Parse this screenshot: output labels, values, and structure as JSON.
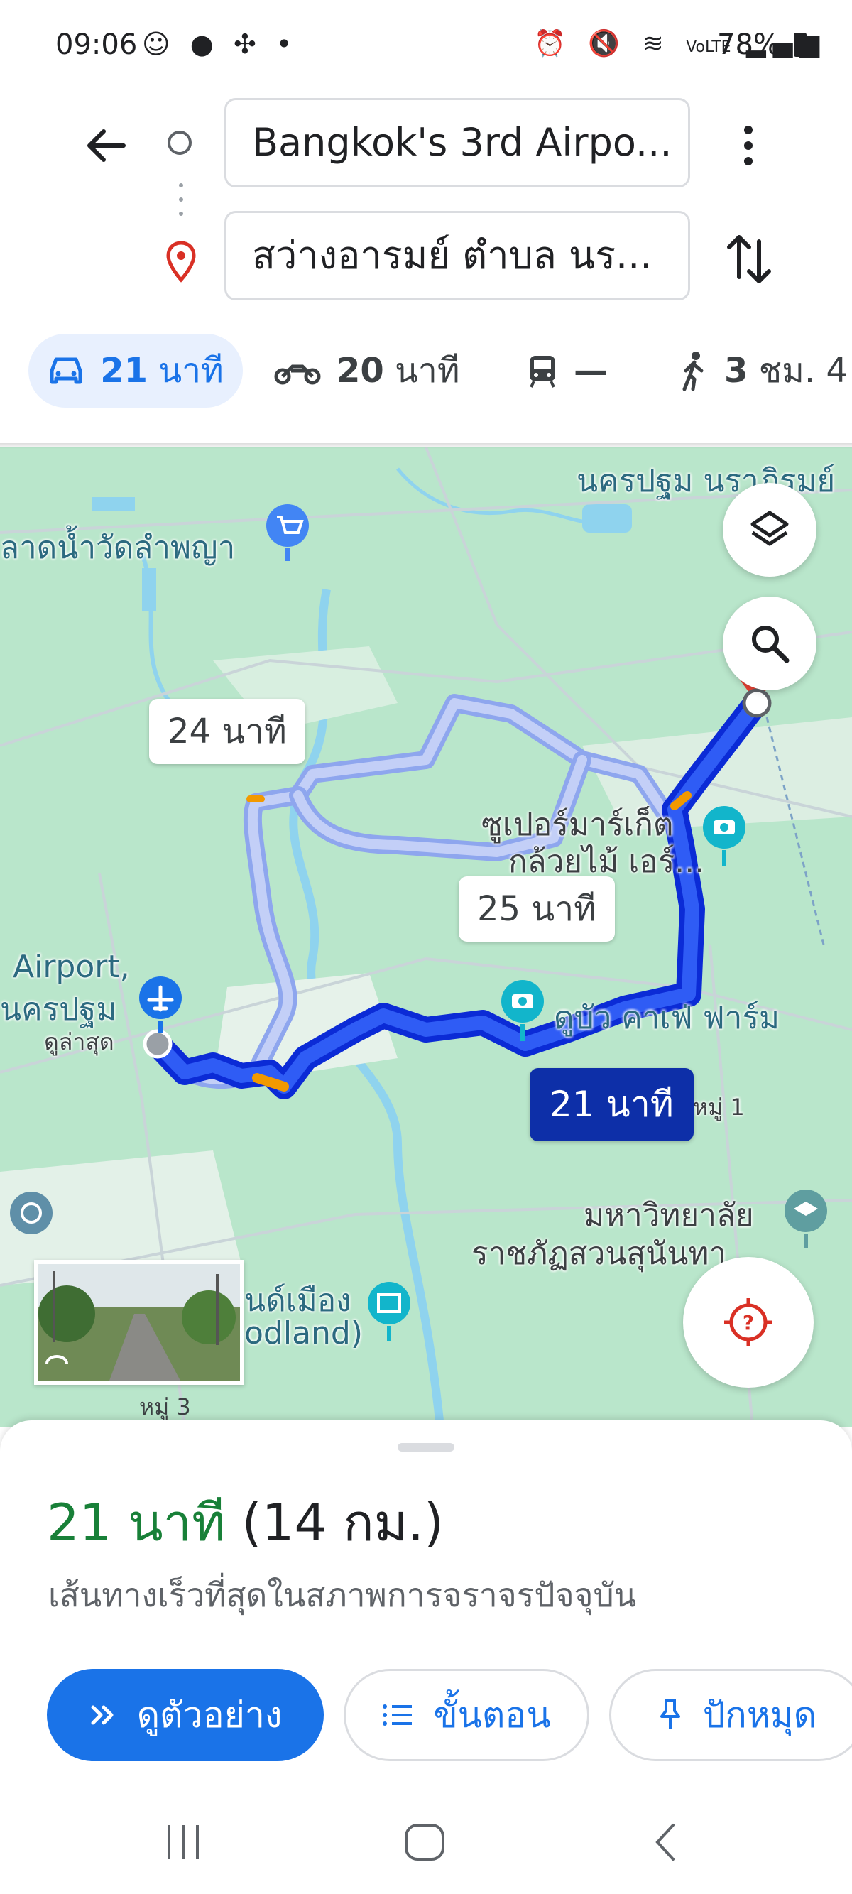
{
  "status_bar": {
    "time": "09:06",
    "left_icons": [
      "face-icon",
      "line-icon",
      "pinwheel-icon",
      "dot-icon"
    ],
    "right_icons": [
      "alarm-icon",
      "mute-icon",
      "wifi-icon",
      "volte-icon",
      "signal-icon"
    ],
    "battery": "78%"
  },
  "search": {
    "origin": "Bangkok's 3rd Airpo...",
    "destination": "สว่างอารมย์ ตำบล นร..."
  },
  "modes": [
    {
      "icon": "car-icon",
      "num": "21",
      "unit": "นาที"
    },
    {
      "icon": "motorcycle-icon",
      "num": "20",
      "unit": "นาที"
    },
    {
      "icon": "transit-icon",
      "num": "—",
      "unit": ""
    },
    {
      "icon": "walk-icon",
      "num": "3",
      "unit": "ชม. 4"
    }
  ],
  "map": {
    "labels": {
      "top_right": "นครปฐม นราภิรมย์",
      "market": "ลาดน้ำวัดลำพญา",
      "supermarket_1": "ซูเปอร์มาร์เก็ต",
      "supermarket_2": "กล้วยไม้ เอร์...",
      "airport_1": "Airport,",
      "airport_2": "นครปฐม",
      "latest": "ดูล่าสุด",
      "cafe": "ดูบัว คาเฟ่ ฟาร์ม",
      "moo1": "หมู่ 1",
      "university_1": "มหาวิทยาลัย",
      "university_2": "ราชภัฏสวนสุนันทา",
      "woodland_1": "นด์เมือง",
      "woodland_2": "odland)",
      "street_view": "หมู่ 3"
    },
    "route_bubbles": {
      "alt1": "24 นาที",
      "alt2": "25 นาที",
      "main": "21 นาที"
    }
  },
  "sheet": {
    "duration": "21 นาที",
    "distance": "(14 กม.)",
    "subtitle": "เส้นทางเร็วที่สุดในสภาพการจราจรปัจจุบัน",
    "preview_label": "ดูตัวอย่าง",
    "steps_label": "ขั้นตอน",
    "pin_label": "ปักหมุด"
  },
  "colors": {
    "accent": "#1a73e8",
    "route_main": "#1a3ff0",
    "route_alt": "#a9b9f3",
    "duration_green": "#188038",
    "map_bg": "#b9e6cb"
  }
}
